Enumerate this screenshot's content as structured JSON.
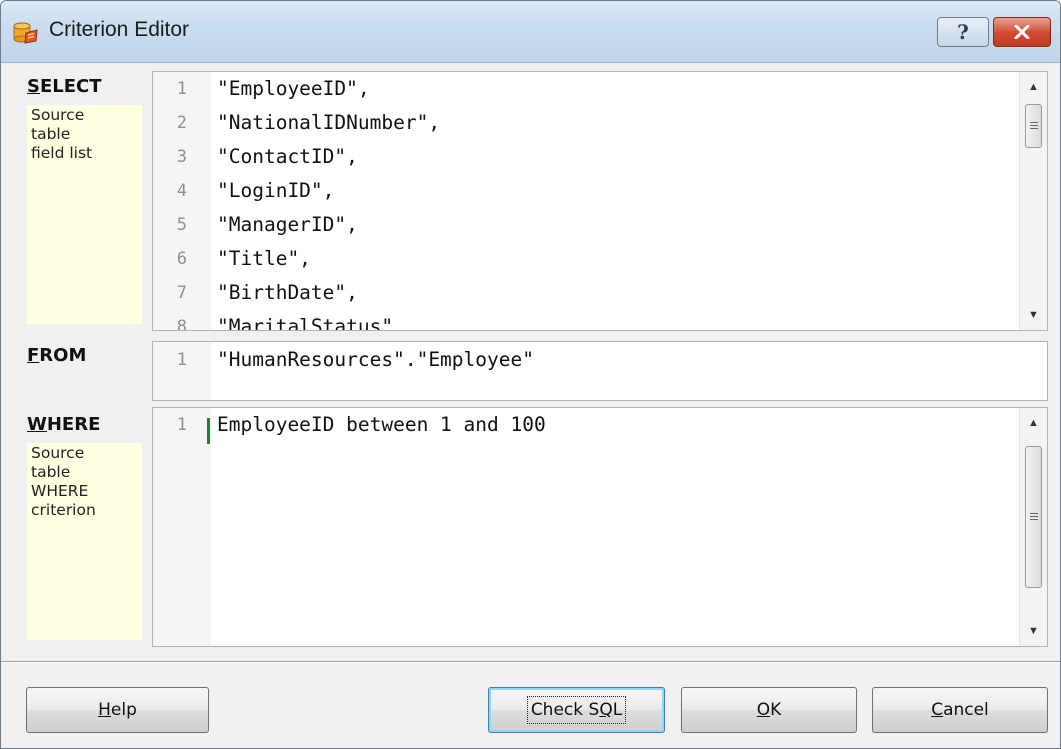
{
  "window": {
    "title": "Criterion Editor",
    "help_glyph": "?",
    "close_glyph": "✕"
  },
  "select_section": {
    "label_accel": "S",
    "label_rest": "ELECT",
    "hint_lines": [
      "Source",
      "table",
      "field list"
    ],
    "lines": [
      {
        "n": "1",
        "code": "\"EmployeeID\","
      },
      {
        "n": "2",
        "code": "\"NationalIDNumber\","
      },
      {
        "n": "3",
        "code": "\"ContactID\","
      },
      {
        "n": "4",
        "code": "\"LoginID\","
      },
      {
        "n": "5",
        "code": "\"ManagerID\","
      },
      {
        "n": "6",
        "code": "\"Title\","
      },
      {
        "n": "7",
        "code": "\"BirthDate\","
      },
      {
        "n": "8",
        "code": "\"MaritalStatus\""
      }
    ]
  },
  "from_section": {
    "label_accel": "F",
    "label_rest": "ROM",
    "lines": [
      {
        "n": "1",
        "code": "\"HumanResources\".\"Employee\""
      }
    ]
  },
  "where_section": {
    "label_accel": "W",
    "label_rest": "HERE",
    "hint_lines": [
      "Source",
      "table",
      "WHERE",
      "criterion"
    ],
    "lines": [
      {
        "n": "1",
        "code": "EmployeeID between 1 and 100"
      }
    ]
  },
  "scrollbar": {
    "up_glyph": "▲",
    "down_glyph": "▼"
  },
  "buttons": {
    "help": {
      "accel": "H",
      "rest": "elp"
    },
    "check_sql": {
      "before": "Check S",
      "accel": "Q",
      "after": "L"
    },
    "ok": {
      "accel": "O",
      "rest": "K"
    },
    "cancel": {
      "accel": "C",
      "rest": "ancel"
    }
  },
  "colors": {
    "hint_background": "#ffffe1",
    "caret": "#138a2a",
    "close_button": "#c13a22"
  }
}
